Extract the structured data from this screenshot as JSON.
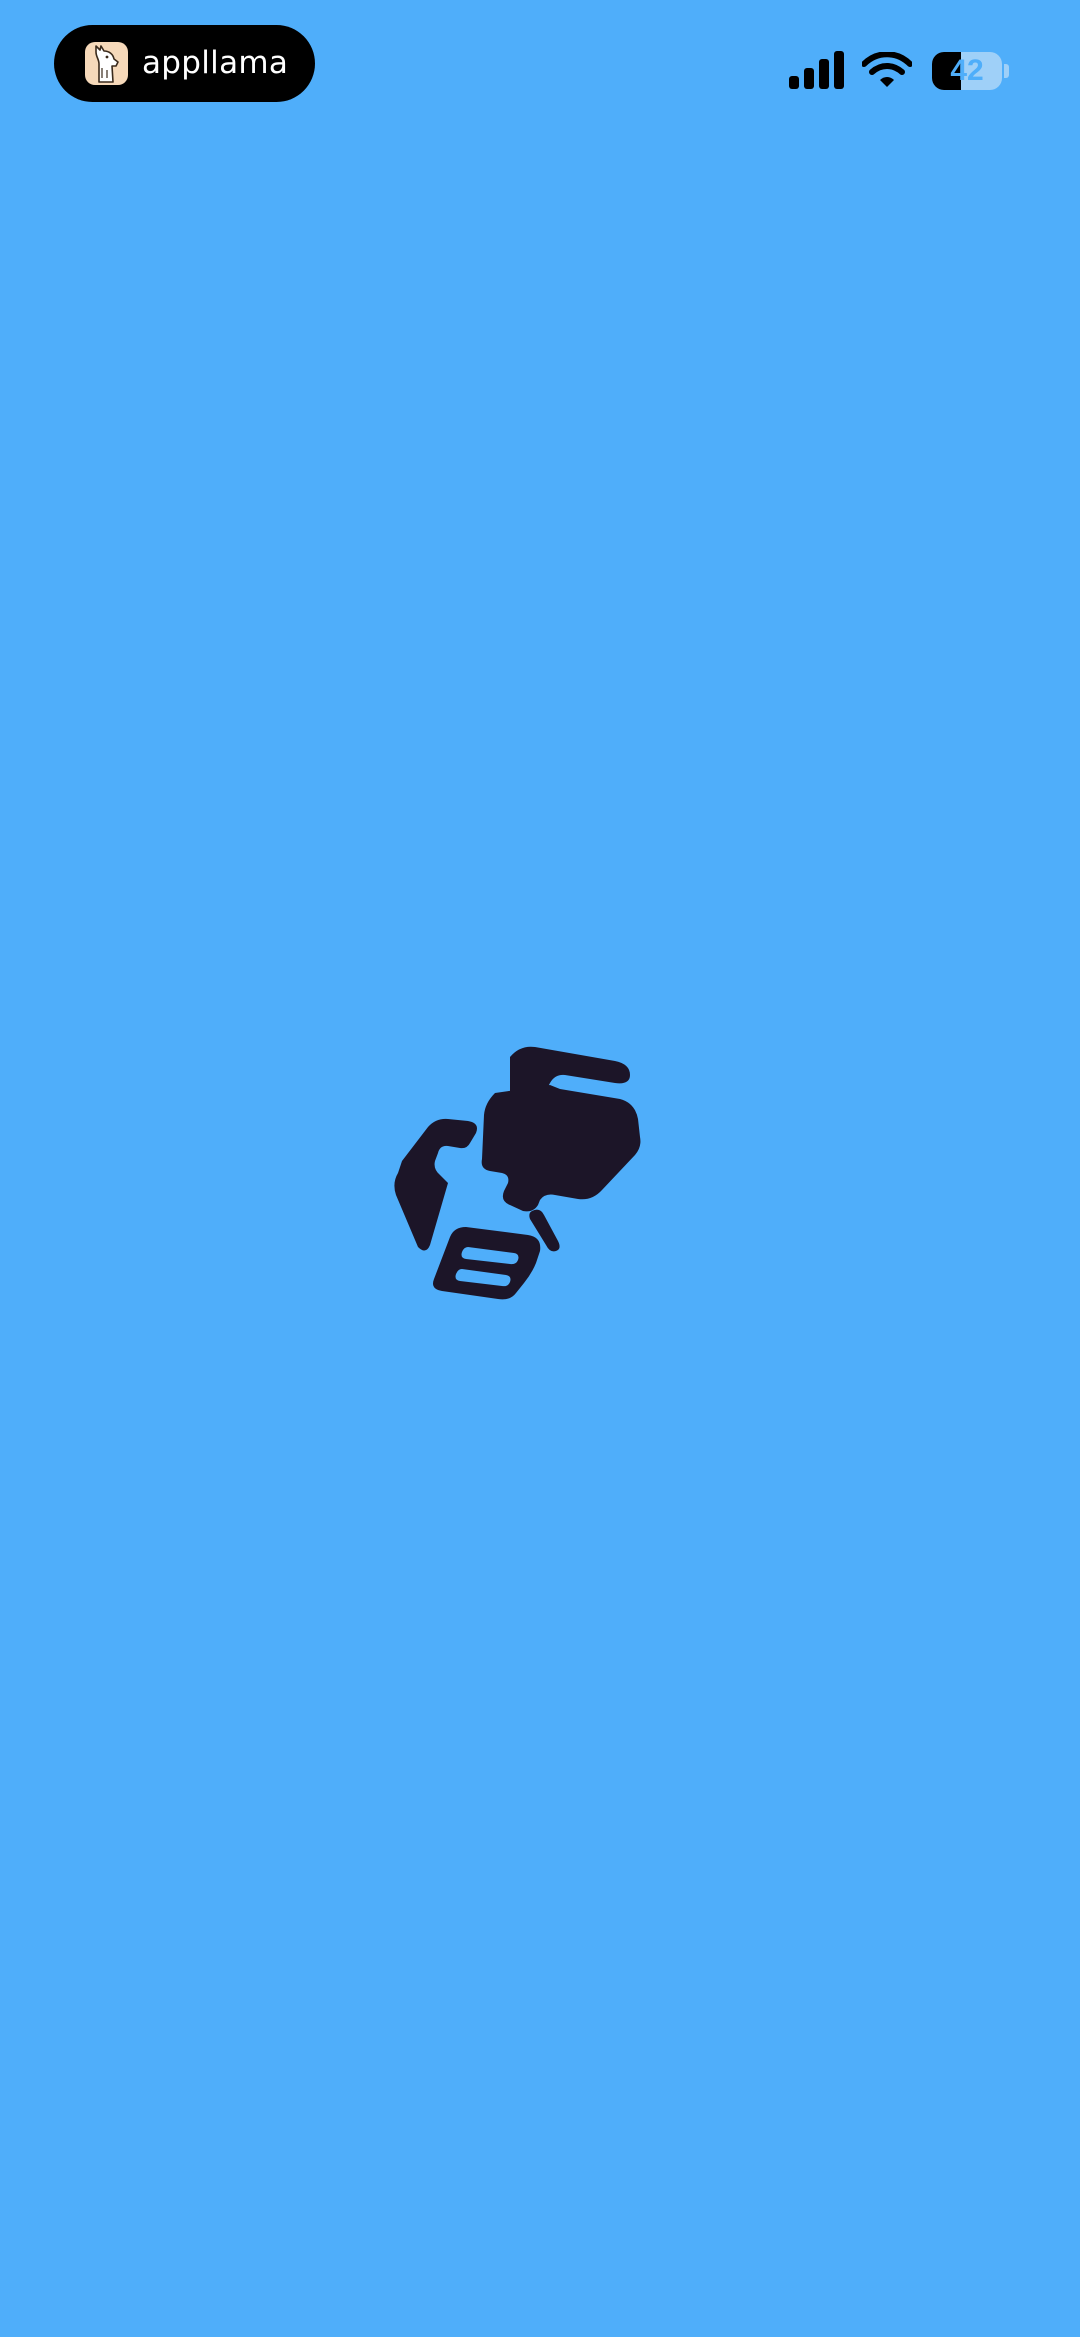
{
  "status_bar": {
    "app_name": "appllama",
    "battery_level": "42",
    "battery_fraction": 0.42,
    "icons": {
      "app_logo": "llama-logo-icon",
      "signal": "cellular-signal-icon",
      "wifi": "wifi-icon",
      "battery": "battery-icon"
    }
  },
  "splash": {
    "logo_icon": "app-splash-logo-icon"
  },
  "colors": {
    "background": "#4faefa",
    "logo": "#1c1528",
    "status_pill": "#000000",
    "battery_empty": "#9fd0f8"
  }
}
